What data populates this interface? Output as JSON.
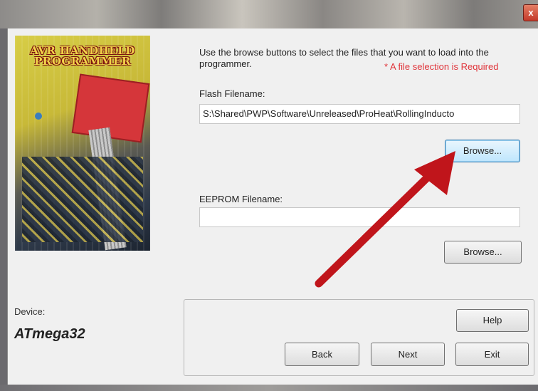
{
  "window": {
    "close_glyph": "x"
  },
  "image": {
    "title_line1": "AVR HANDHELD",
    "title_line2": "PROGRAMMER"
  },
  "instructions": "Use the browse buttons to select the files that you want to load into the programmer.",
  "required_note": "* A file selection is Required",
  "flash": {
    "label": "Flash Filename:",
    "value": "S:\\Shared\\PWP\\Software\\Unreleased\\ProHeat\\RollingInducto",
    "browse_label": "Browse..."
  },
  "eeprom": {
    "label": "EEPROM Filename:",
    "value": "",
    "browse_label": "Browse..."
  },
  "device": {
    "label": "Device:",
    "value": "ATmega32"
  },
  "buttons": {
    "help": "Help",
    "back": "Back",
    "next": "Next",
    "exit": "Exit"
  },
  "annotation": {
    "arrow_color": "#c0151b"
  }
}
